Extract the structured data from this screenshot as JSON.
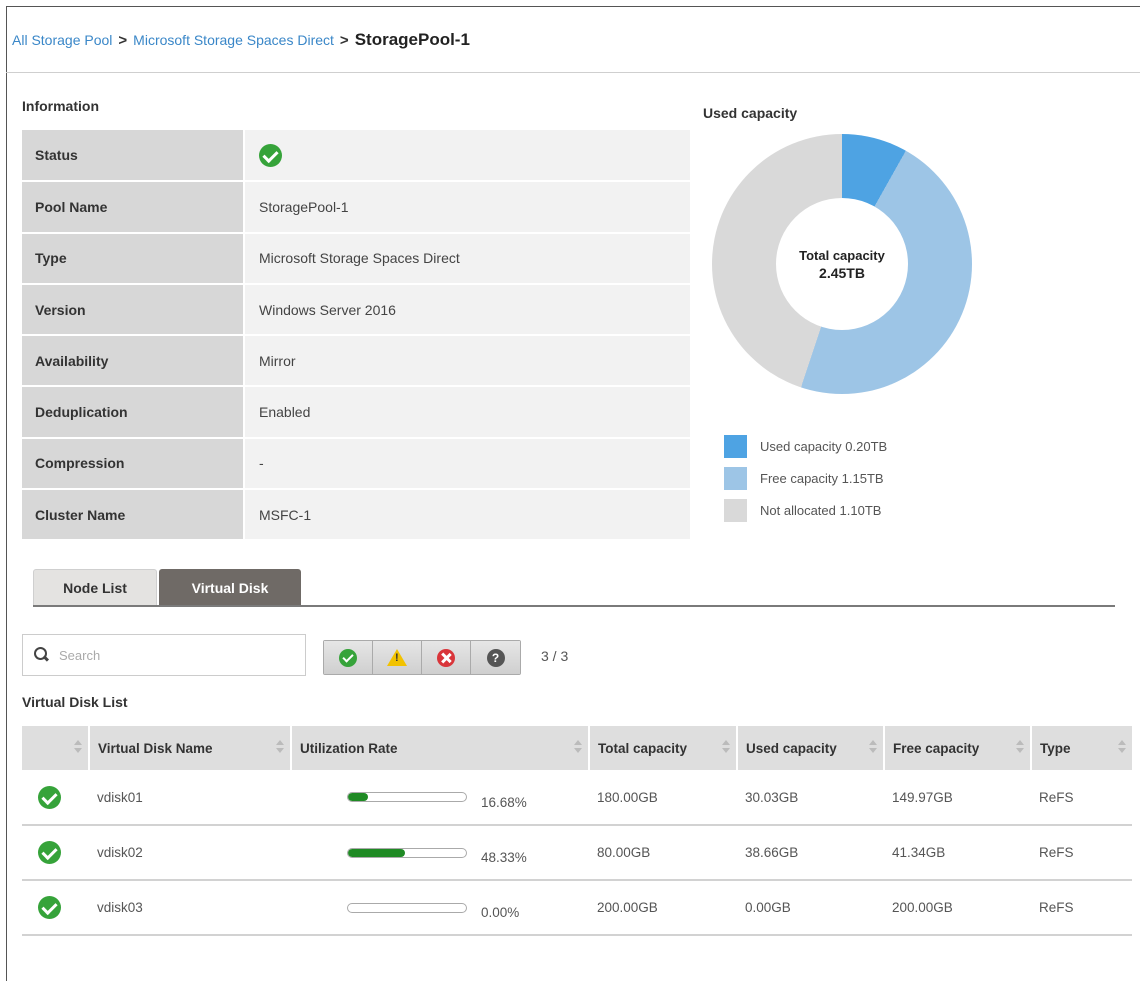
{
  "breadcrumb": {
    "items": [
      "All Storage Pool",
      "Microsoft Storage Spaces Direct"
    ],
    "current": "StoragePool-1",
    "separator": ">"
  },
  "information": {
    "title": "Information",
    "rows": [
      {
        "label": "Status",
        "value": "",
        "icon": "check-circle-icon"
      },
      {
        "label": "Pool Name",
        "value": "StoragePool-1"
      },
      {
        "label": "Type",
        "value": "Microsoft Storage Spaces Direct"
      },
      {
        "label": "Version",
        "value": "Windows Server 2016"
      },
      {
        "label": "Availability",
        "value": "Mirror"
      },
      {
        "label": "Deduplication",
        "value": "Enabled"
      },
      {
        "label": "Compression",
        "value": "-"
      },
      {
        "label": "Cluster Name",
        "value": "MSFC-1"
      }
    ]
  },
  "capacity": {
    "title": "Used capacity",
    "center_label": "Total capacity",
    "center_value": "2.45TB",
    "segments": [
      {
        "label": "Used capacity",
        "value": "0.20TB",
        "amount": 0.2,
        "color": "#4ea3e3"
      },
      {
        "label": "Free capacity",
        "value": "1.15TB",
        "amount": 1.15,
        "color": "#9dc5e6"
      },
      {
        "label": "Not allocated",
        "value": "1.10TB",
        "amount": 1.1,
        "color": "#d9d9d9"
      }
    ]
  },
  "tabs": [
    {
      "label": "Node List",
      "active": false
    },
    {
      "label": "Virtual Disk",
      "active": true
    }
  ],
  "search": {
    "placeholder": "Search"
  },
  "filters": {
    "buttons": [
      "ok-filter",
      "warning-filter",
      "error-filter",
      "unknown-filter"
    ],
    "count": "3 / 3"
  },
  "virtual_disk_list": {
    "title": "Virtual Disk List",
    "columns": [
      "",
      "Virtual Disk Name",
      "Utilization Rate",
      "Total capacity",
      "Used capacity",
      "Free capacity",
      "Type"
    ],
    "rows": [
      {
        "name": "vdisk01",
        "utilization": "16.68%",
        "utilization_fraction": 0.1668,
        "total": "180.00GB",
        "used": "30.03GB",
        "free": "149.97GB",
        "type": "ReFS"
      },
      {
        "name": "vdisk02",
        "utilization": "48.33%",
        "utilization_fraction": 0.4833,
        "total": "80.00GB",
        "used": "38.66GB",
        "free": "41.34GB",
        "type": "ReFS"
      },
      {
        "name": "vdisk03",
        "utilization": "0.00%",
        "utilization_fraction": 0.0,
        "total": "200.00GB",
        "used": "0.00GB",
        "free": "200.00GB",
        "type": "ReFS"
      }
    ]
  },
  "colors": {
    "link": "#3a87c8",
    "ok": "#36a33a",
    "bar_fill": "#1f8a24",
    "active_tab": "#6f6a66"
  }
}
